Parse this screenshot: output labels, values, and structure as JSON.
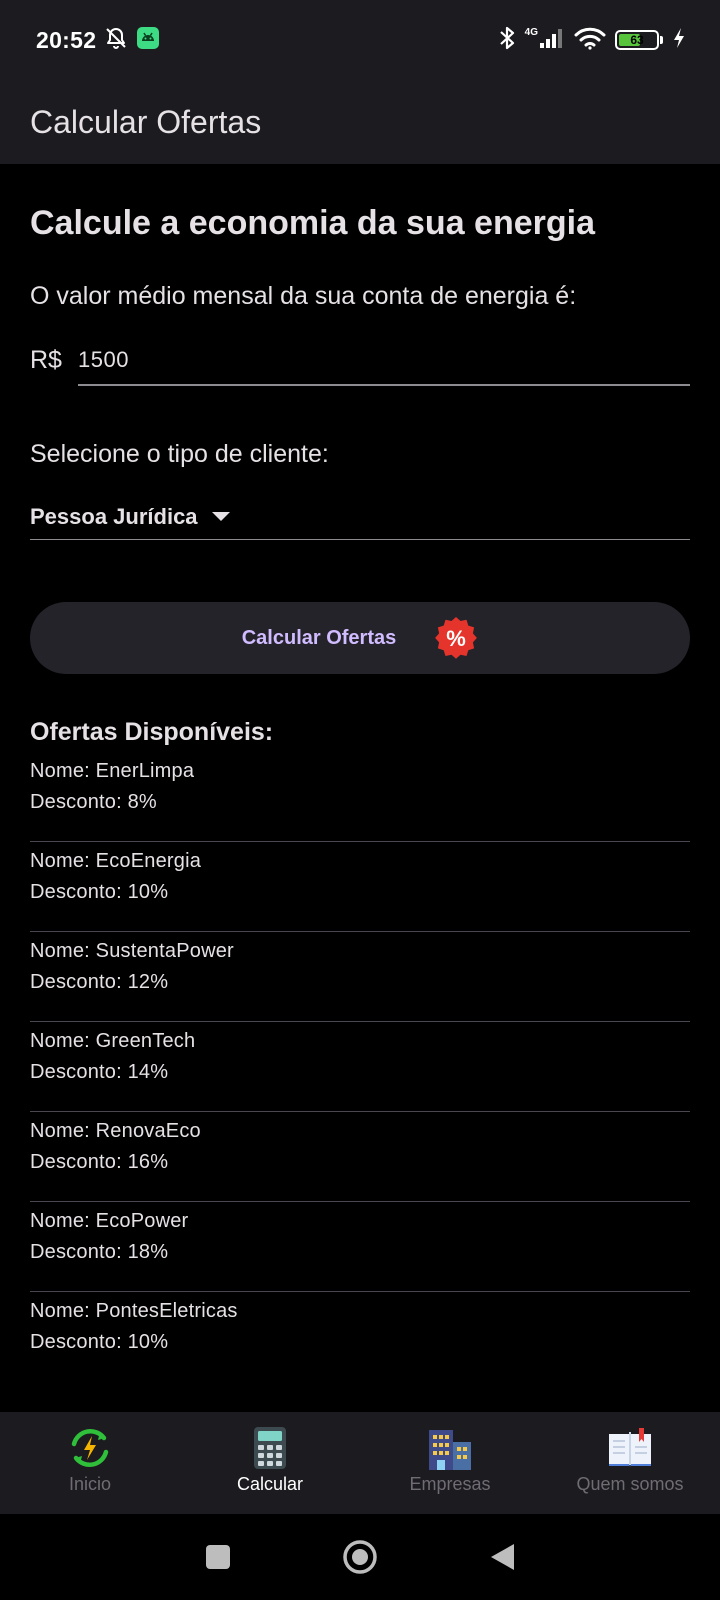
{
  "status_bar": {
    "time": "20:52",
    "network_label": "4G",
    "battery_level": "63",
    "battery_fraction": 0.63
  },
  "app_bar": {
    "title": "Calcular Ofertas"
  },
  "calculator": {
    "headline": "Calcule a economia da sua energia",
    "question": "O valor médio mensal da sua conta de energia é:",
    "currency_prefix": "R$",
    "amount_value": "1500",
    "client_type_label": "Selecione o tipo de cliente:",
    "client_type_selected": "Pessoa Jurídica",
    "calculate_button_label": "Calcular Ofertas",
    "badge_symbol": "%"
  },
  "offers": {
    "title": "Ofertas Disponíveis:",
    "items": [
      {
        "name": "Nome: EnerLimpa",
        "discount": "Desconto: 8%"
      },
      {
        "name": "Nome: EcoEnergia",
        "discount": "Desconto: 10%"
      },
      {
        "name": "Nome: SustentaPower",
        "discount": "Desconto: 12%"
      },
      {
        "name": "Nome: GreenTech",
        "discount": "Desconto: 14%"
      },
      {
        "name": "Nome: RenovaEco",
        "discount": "Desconto: 16%"
      },
      {
        "name": "Nome: EcoPower",
        "discount": "Desconto: 18%"
      },
      {
        "name": "Nome: PontesEletricas",
        "discount": "Desconto: 10%"
      }
    ]
  },
  "bottom_nav": {
    "items": [
      {
        "label": "Inicio",
        "icon": "energy-cycle-icon"
      },
      {
        "label": "Calcular",
        "icon": "calculator-icon",
        "active": true
      },
      {
        "label": "Empresas",
        "icon": "buildings-icon"
      },
      {
        "label": "Quem somos",
        "icon": "open-book-icon"
      }
    ]
  },
  "colors": {
    "background": "#000000",
    "surface": "#1c1b1f",
    "accent": "#d0bcff",
    "badge": "#e5342b",
    "text": "#e6e1e5",
    "nav_inactive": "#6f6c73"
  }
}
